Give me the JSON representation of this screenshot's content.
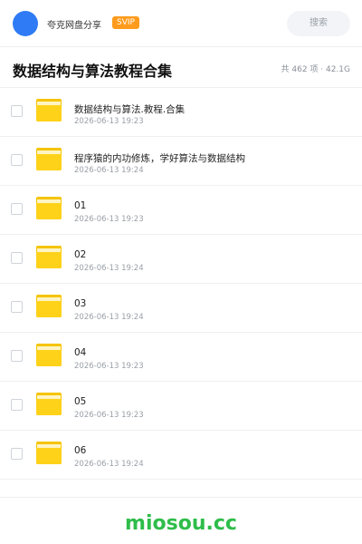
{
  "header": {
    "username": "夸克网盘分享",
    "badge": "SVIP",
    "search_label": "搜索"
  },
  "share": {
    "title": "数据结构与算法教程合集",
    "meta": "共 462 项 · 42.1G"
  },
  "files": [
    {
      "name": "数据结构与算法.教程.合集",
      "date": "2026-06-13 19:23"
    },
    {
      "name": "程序猿的内功修炼，学好算法与数据结构",
      "date": "2026-06-13 19:24"
    },
    {
      "name": "01",
      "date": "2026-06-13 19:23"
    },
    {
      "name": "02",
      "date": "2026-06-13 19:24"
    },
    {
      "name": "03",
      "date": "2026-06-13 19:24"
    },
    {
      "name": "04",
      "date": "2026-06-13 19:23"
    },
    {
      "name": "05",
      "date": "2026-06-13 19:23"
    },
    {
      "name": "06",
      "date": "2026-06-13 19:24"
    }
  ],
  "watermark": "miosou.cc",
  "colors": {
    "accent": "#2f7bf5",
    "badge": "#ff9b1c",
    "folder": "#ffd21a",
    "watermark": "#2ebd4a"
  }
}
